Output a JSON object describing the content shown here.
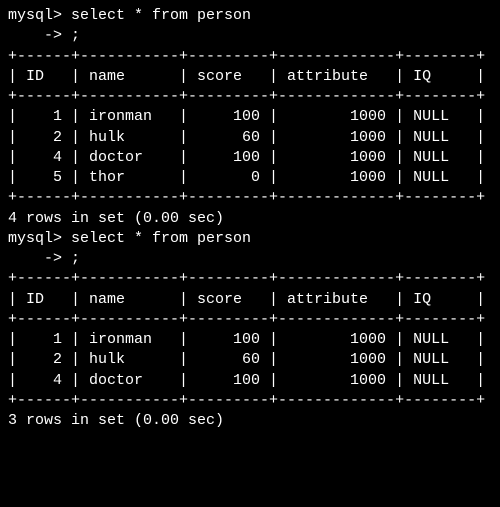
{
  "prompt": "mysql>",
  "continuation": "    ->",
  "query": "select * from person",
  "semicolon": ";",
  "columns": [
    "ID",
    "name",
    "score",
    "attribute",
    "IQ"
  ],
  "queries": [
    {
      "rows": [
        {
          "ID": 1,
          "name": "ironman",
          "score": 100,
          "attribute": 1000,
          "IQ": "NULL"
        },
        {
          "ID": 2,
          "name": "hulk",
          "score": 60,
          "attribute": 1000,
          "IQ": "NULL"
        },
        {
          "ID": 4,
          "name": "doctor",
          "score": 100,
          "attribute": 1000,
          "IQ": "NULL"
        },
        {
          "ID": 5,
          "name": "thor",
          "score": 0,
          "attribute": 1000,
          "IQ": "NULL"
        }
      ],
      "summary": "4 rows in set (0.00 sec)"
    },
    {
      "rows": [
        {
          "ID": 1,
          "name": "ironman",
          "score": 100,
          "attribute": 1000,
          "IQ": "NULL"
        },
        {
          "ID": 2,
          "name": "hulk",
          "score": 60,
          "attribute": 1000,
          "IQ": "NULL"
        },
        {
          "ID": 4,
          "name": "doctor",
          "score": 100,
          "attribute": 1000,
          "IQ": "NULL"
        }
      ],
      "summary": "3 rows in set (0.00 sec)"
    }
  ],
  "widths": {
    "ID": 4,
    "name": 9,
    "score": 7,
    "attribute": 11,
    "IQ": 6
  }
}
